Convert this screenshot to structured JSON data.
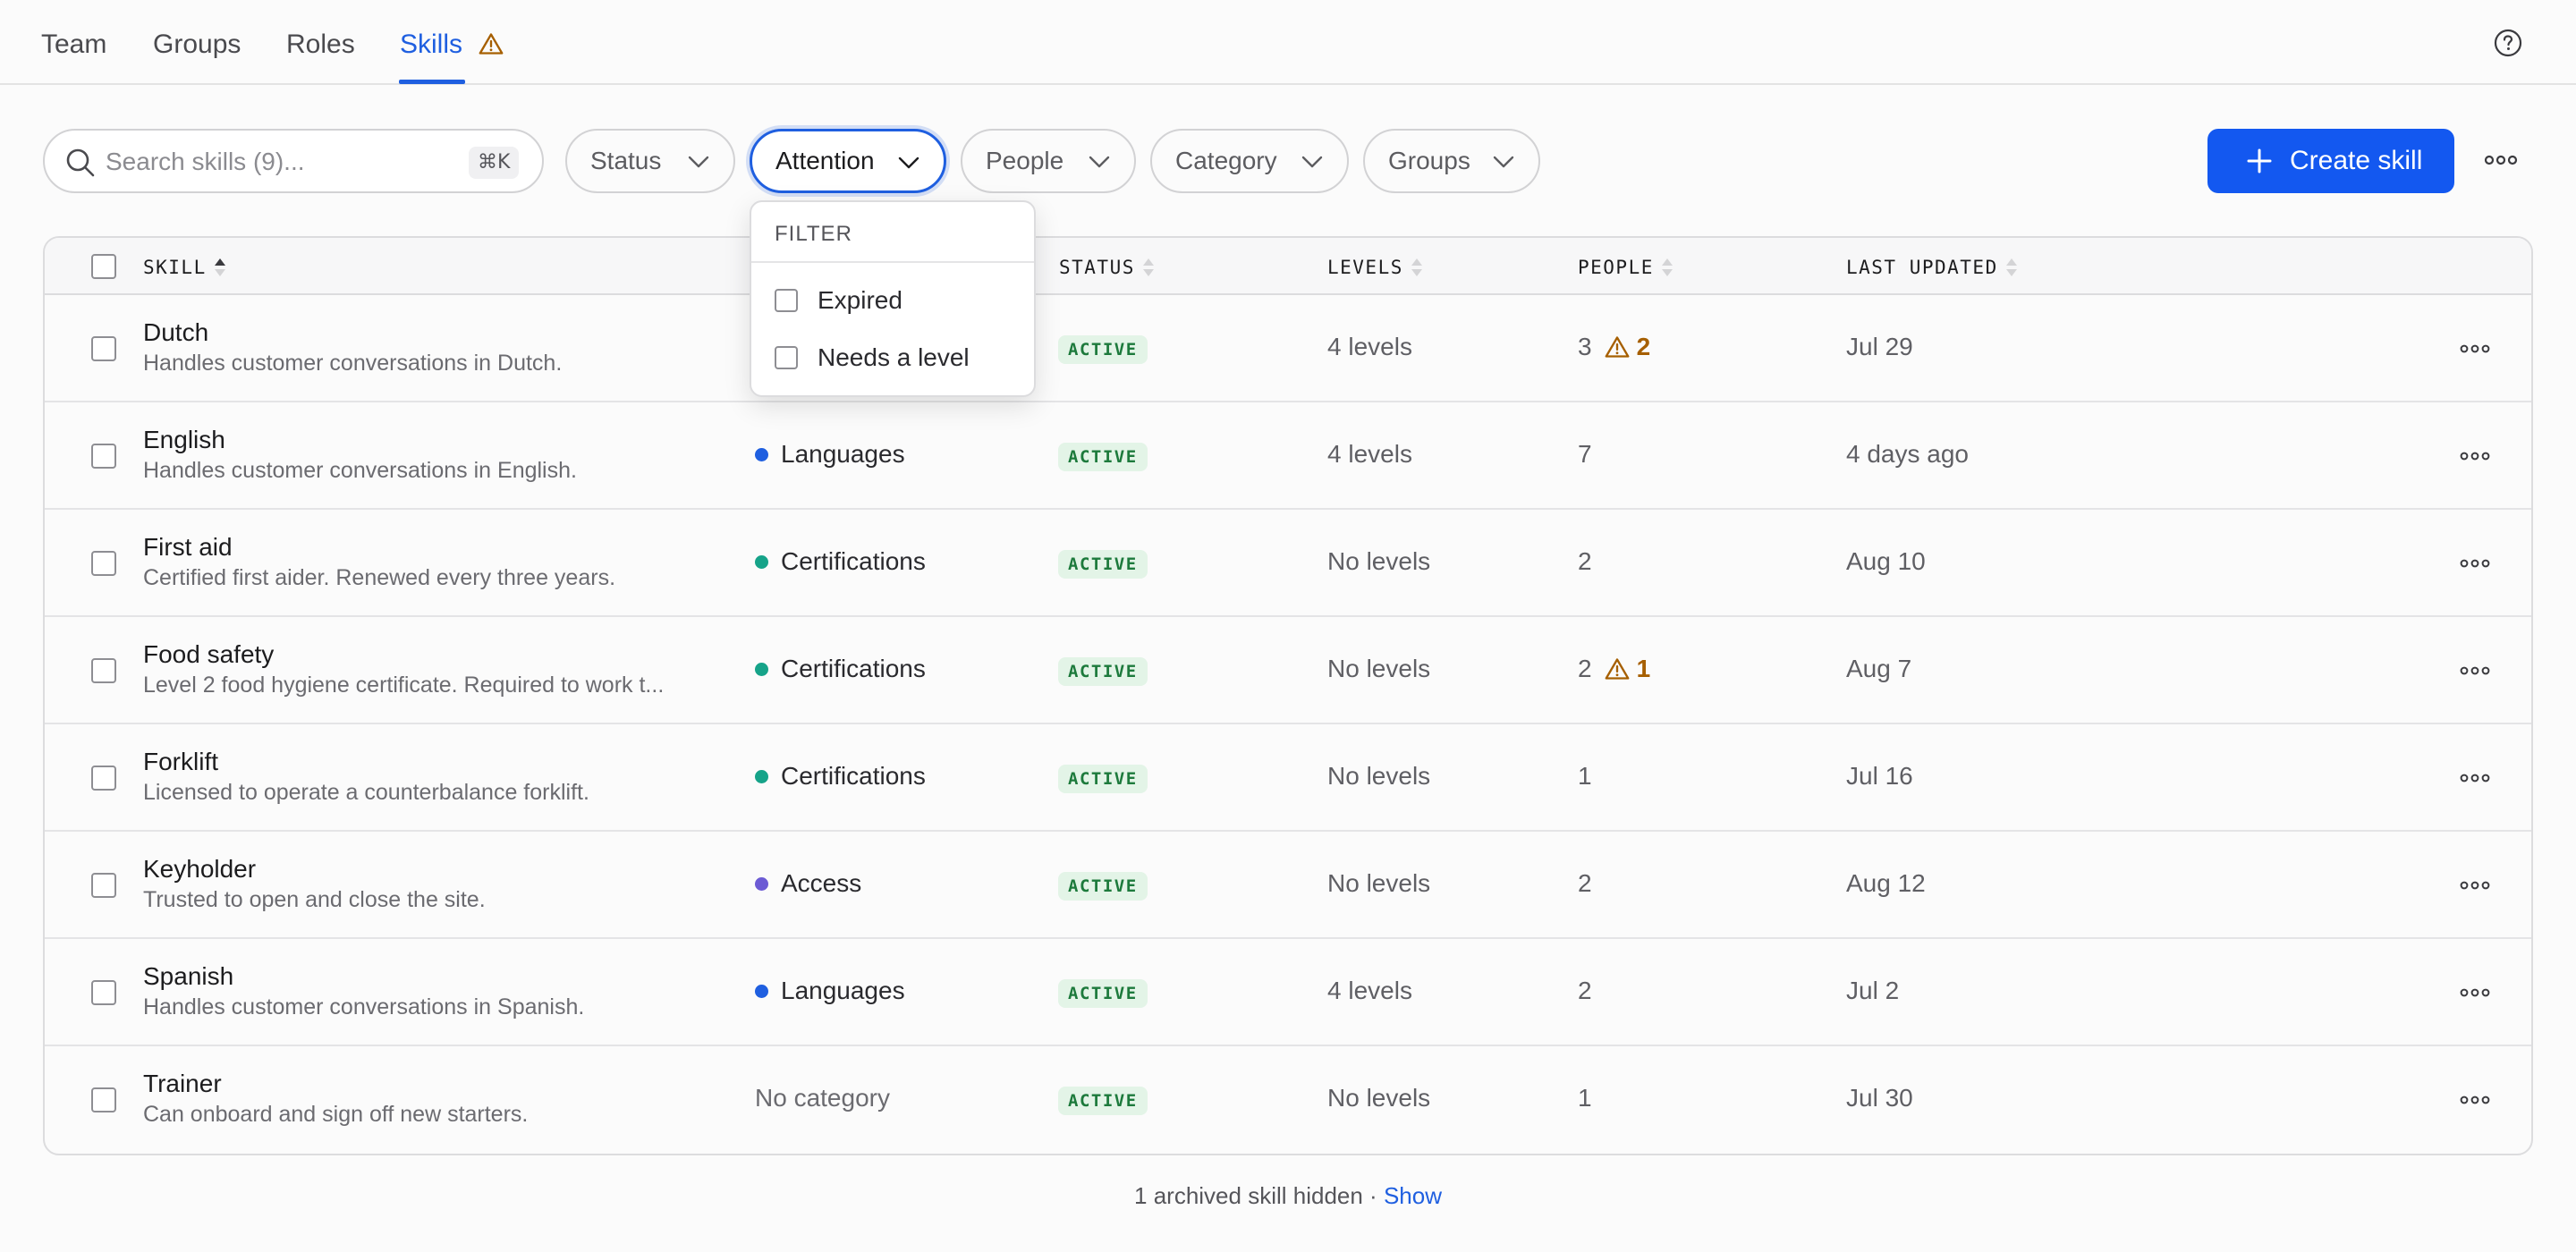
{
  "nav": {
    "tabs": [
      {
        "label": "Team"
      },
      {
        "label": "Groups"
      },
      {
        "label": "Roles"
      },
      {
        "label": "Skills",
        "active": true,
        "icon": "warning-icon"
      }
    ],
    "help_icon": "help-circle-icon"
  },
  "toolbar": {
    "search_placeholder": "Search skills (9)...",
    "search_shortcut": "⌘K",
    "filters": [
      "Status",
      "Attention",
      "People",
      "Category",
      "Groups"
    ],
    "active_filter": "Attention",
    "create_label": "Create skill"
  },
  "dropdown": {
    "title": "FILTER",
    "options": [
      {
        "label": "Expired",
        "checked": false
      },
      {
        "label": "Needs a level",
        "checked": false
      }
    ]
  },
  "table": {
    "columns": [
      "SKILL",
      "STATUS",
      "LEVELS",
      "PEOPLE",
      "LAST UPDATED"
    ],
    "rows": [
      {
        "name": "Dutch",
        "description": "Handles customer conversations in Dutch.",
        "category": "",
        "category_color": "",
        "status": "ACTIVE",
        "levels": "4 levels",
        "people": "3",
        "attention": "2",
        "updated": "Jul 29"
      },
      {
        "name": "English",
        "description": "Handles customer conversations in English.",
        "category": "Languages",
        "category_color": "#1f5fe0",
        "status": "ACTIVE",
        "levels": "4 levels",
        "people": "7",
        "attention": "",
        "updated": "4 days ago"
      },
      {
        "name": "First aid",
        "description": "Certified first aider. Renewed every three years.",
        "category": "Certifications",
        "category_color": "#16a389",
        "status": "ACTIVE",
        "levels": "No levels",
        "people": "2",
        "attention": "",
        "updated": "Aug 10"
      },
      {
        "name": "Food safety",
        "description": "Level 2 food hygiene certificate. Required to work t...",
        "category": "Certifications",
        "category_color": "#16a389",
        "status": "ACTIVE",
        "levels": "No levels",
        "people": "2",
        "attention": "1",
        "updated": "Aug 7"
      },
      {
        "name": "Forklift",
        "description": "Licensed to operate a counterbalance forklift.",
        "category": "Certifications",
        "category_color": "#16a389",
        "status": "ACTIVE",
        "levels": "No levels",
        "people": "1",
        "attention": "",
        "updated": "Jul 16"
      },
      {
        "name": "Keyholder",
        "description": "Trusted to open and close the site.",
        "category": "Access",
        "category_color": "#6c5bd4",
        "status": "ACTIVE",
        "levels": "No levels",
        "people": "2",
        "attention": "",
        "updated": "Aug 12"
      },
      {
        "name": "Spanish",
        "description": "Handles customer conversations in Spanish.",
        "category": "Languages",
        "category_color": "#1f5fe0",
        "status": "ACTIVE",
        "levels": "4 levels",
        "people": "2",
        "attention": "",
        "updated": "Jul 2"
      },
      {
        "name": "Trainer",
        "description": "Can onboard and sign off new starters.",
        "category": "No category",
        "category_color": "",
        "status": "ACTIVE",
        "levels": "No levels",
        "people": "1",
        "attention": "",
        "updated": "Jul 30"
      }
    ]
  },
  "footer": {
    "text": "1 archived skill hidden · ",
    "link": "Show"
  },
  "colors": {
    "accent": "#1f5fe0",
    "primary_button": "#1358f0",
    "active_badge_bg": "#e3f4e7",
    "active_badge_text": "#1d7a3c",
    "warning": "#a65f00"
  }
}
